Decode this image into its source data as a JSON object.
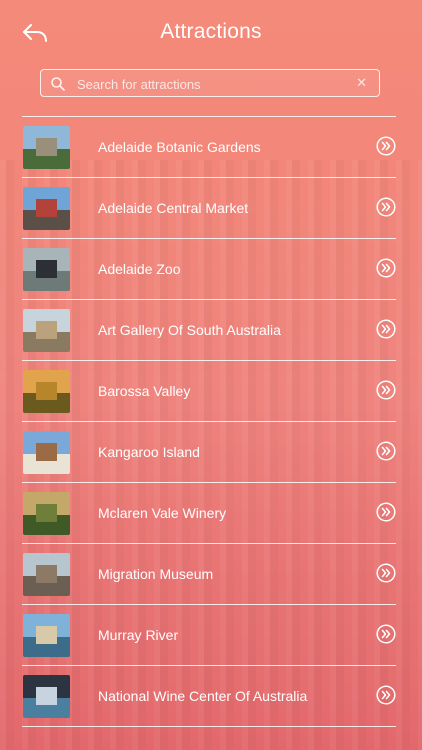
{
  "header": {
    "title": "Attractions",
    "back_icon": "back-arrow-icon"
  },
  "search": {
    "placeholder": "Search for attractions",
    "value": "",
    "clear_glyph": "✕"
  },
  "attractions": [
    {
      "label": "Adelaide Botanic Gardens",
      "thumb": {
        "sky": "#8fb7d8",
        "ground": "#4a6b3a",
        "obj": "#9a8f7a"
      }
    },
    {
      "label": "Adelaide Central Market",
      "thumb": {
        "sky": "#6fa4d6",
        "ground": "#5b5048",
        "obj": "#b3423a"
      }
    },
    {
      "label": "Adelaide Zoo",
      "thumb": {
        "sky": "#a7b4b8",
        "ground": "#6e7a78",
        "obj": "#2c2f33"
      }
    },
    {
      "label": "Art Gallery Of South Australia",
      "thumb": {
        "sky": "#c8d4dc",
        "ground": "#8a7a62",
        "obj": "#b9a27c"
      }
    },
    {
      "label": "Barossa Valley",
      "thumb": {
        "sky": "#e1a34b",
        "ground": "#6a5a1e",
        "obj": "#b7862a"
      }
    },
    {
      "label": "Kangaroo Island",
      "thumb": {
        "sky": "#7aa8d8",
        "ground": "#e9e3d6",
        "obj": "#9a6b45"
      }
    },
    {
      "label": "Mclaren Vale Winery",
      "thumb": {
        "sky": "#c3a86a",
        "ground": "#3f5a26",
        "obj": "#6f7f3a"
      }
    },
    {
      "label": "Migration Museum",
      "thumb": {
        "sky": "#b7c5cf",
        "ground": "#6b5e52",
        "obj": "#8d7a66"
      }
    },
    {
      "label": "Murray River",
      "thumb": {
        "sky": "#7fb2d8",
        "ground": "#3d6c8a",
        "obj": "#d8c9a8"
      }
    },
    {
      "label": "National Wine Center Of Australia",
      "thumb": {
        "sky": "#2b3440",
        "ground": "#4b7fa0",
        "obj": "#c7d4df"
      }
    }
  ],
  "colors": {
    "background_top": "#f48a7a",
    "background_bottom": "#e86d70",
    "divider": "#ffffff"
  }
}
